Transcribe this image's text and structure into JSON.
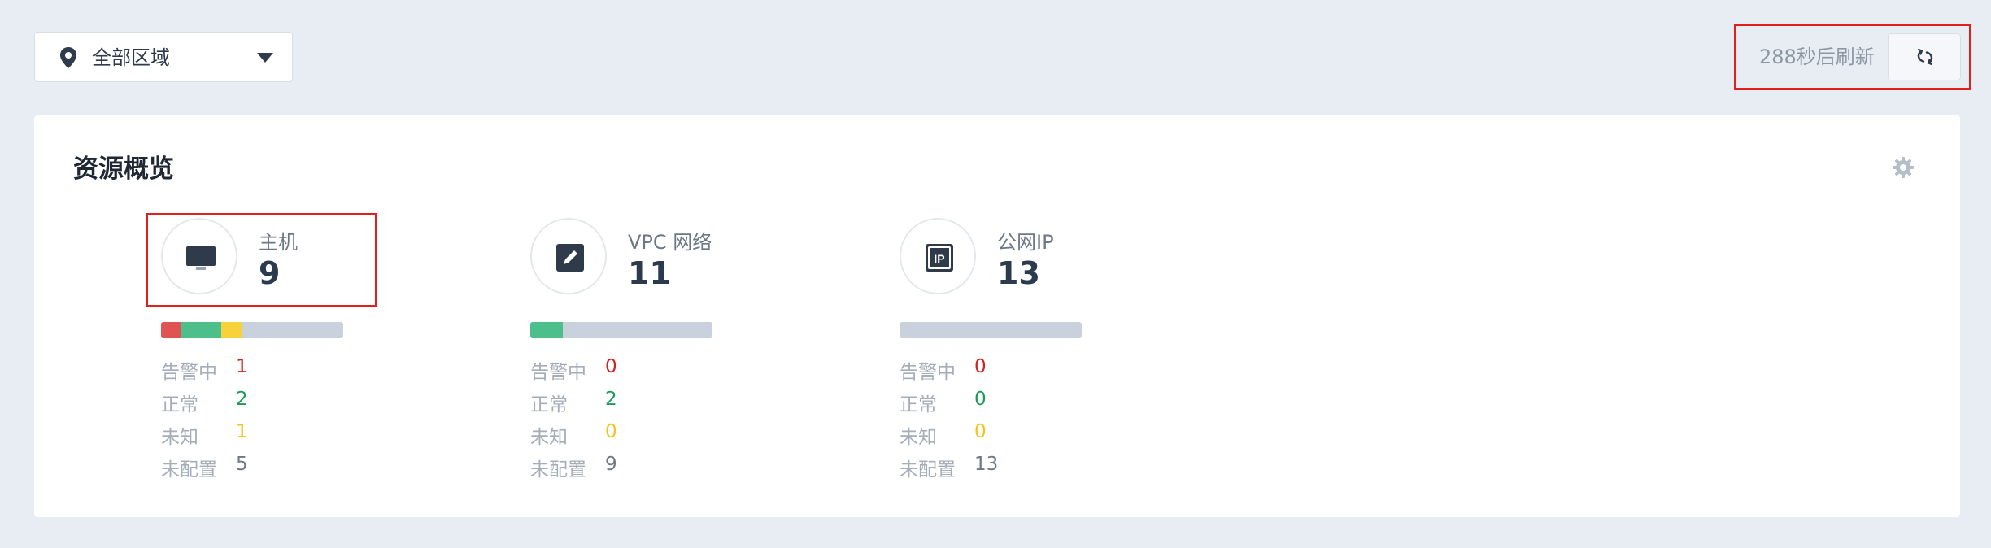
{
  "region_selector": {
    "label": "全部区域",
    "icons": [
      "map-pin-icon",
      "caret-down-icon"
    ]
  },
  "refresh": {
    "label": "288秒后刷新",
    "icon": "refresh-icon"
  },
  "overview": {
    "title": "资源概览",
    "settings_icon": "gear-icon",
    "resources": [
      {
        "name": "主机",
        "count": "9",
        "icon": "monitor-icon",
        "stats": [
          {
            "label": "告警中",
            "value": "1"
          },
          {
            "label": "正常",
            "value": "2"
          },
          {
            "label": "未知",
            "value": "1"
          },
          {
            "label": "未配置",
            "value": "5"
          }
        ]
      },
      {
        "name": "VPC 网络",
        "count": "11",
        "icon": "vpc-edit-icon",
        "stats": [
          {
            "label": "告警中",
            "value": "0"
          },
          {
            "label": "正常",
            "value": "2"
          },
          {
            "label": "未知",
            "value": "0"
          },
          {
            "label": "未配置",
            "value": "9"
          }
        ]
      },
      {
        "name": "公网IP",
        "count": "13",
        "icon": "ip-icon",
        "stats": [
          {
            "label": "告警中",
            "value": "0"
          },
          {
            "label": "正常",
            "value": "0"
          },
          {
            "label": "未知",
            "value": "0"
          },
          {
            "label": "未配置",
            "value": "13"
          }
        ]
      }
    ],
    "status_colors": {
      "alarm": "#e05353",
      "normal": "#4cbf8b",
      "unknown": "#f7d23a",
      "unconfigured": "#c9d2dc"
    }
  }
}
